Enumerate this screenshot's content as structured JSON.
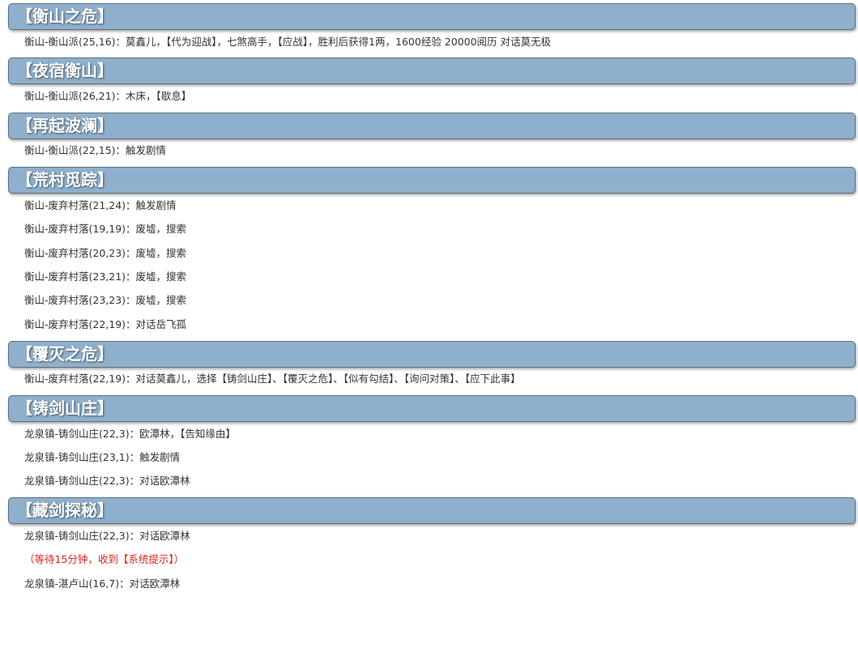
{
  "sections": [
    {
      "title": "【衡山之危】",
      "lines": [
        {
          "text": "衡山-衡山派(25,16)：莫鑫儿，【代为迎战】，七煞高手，【应战】，胜利后获得1两，1600经验 20000阅历 对话莫无极",
          "note": false
        }
      ]
    },
    {
      "title": "【夜宿衡山】",
      "lines": [
        {
          "text": "衡山-衡山派(26,21)：木床，【歇息】",
          "note": false
        }
      ]
    },
    {
      "title": "【再起波澜】",
      "lines": [
        {
          "text": "衡山-衡山派(22,15)：触发剧情",
          "note": false
        }
      ]
    },
    {
      "title": "【荒村觅踪】",
      "lines": [
        {
          "text": "衡山-废弃村落(21,24)：触发剧情",
          "note": false
        },
        {
          "text": "衡山-废弃村落(19,19)：废墟，搜索",
          "note": false
        },
        {
          "text": "衡山-废弃村落(20,23)：废墟，搜索",
          "note": false
        },
        {
          "text": "衡山-废弃村落(23,21)：废墟，搜索",
          "note": false
        },
        {
          "text": "衡山-废弃村落(23,23)：废墟，搜索",
          "note": false
        },
        {
          "text": "衡山-废弃村落(22,19)：对话岳飞孤",
          "note": false
        }
      ]
    },
    {
      "title": "【覆灭之危】",
      "lines": [
        {
          "text": "衡山-废弃村落(22,19)：对话莫鑫儿，选择【铸剑山庄】、【覆灭之危】、【似有勾结】、【询问对策】、【应下此事】",
          "note": false
        }
      ]
    },
    {
      "title": "【铸剑山庄】",
      "lines": [
        {
          "text": "龙泉镇-铸剑山庄(22,3)：欧潭林，【告知缘由】",
          "note": false
        },
        {
          "text": "龙泉镇-铸剑山庄(23,1)：触发剧情",
          "note": false
        },
        {
          "text": "龙泉镇-铸剑山庄(22,3)：对话欧潭林",
          "note": false
        }
      ]
    },
    {
      "title": "【藏剑探秘】",
      "lines": [
        {
          "text": "龙泉镇-铸剑山庄(22,3)：对话欧潭林",
          "note": false
        },
        {
          "text": "（等待15分钟，收到【系统提示】）",
          "note": true
        },
        {
          "text": "龙泉镇-湛卢山(16,7)：对话欧潭林",
          "note": false
        }
      ]
    }
  ]
}
